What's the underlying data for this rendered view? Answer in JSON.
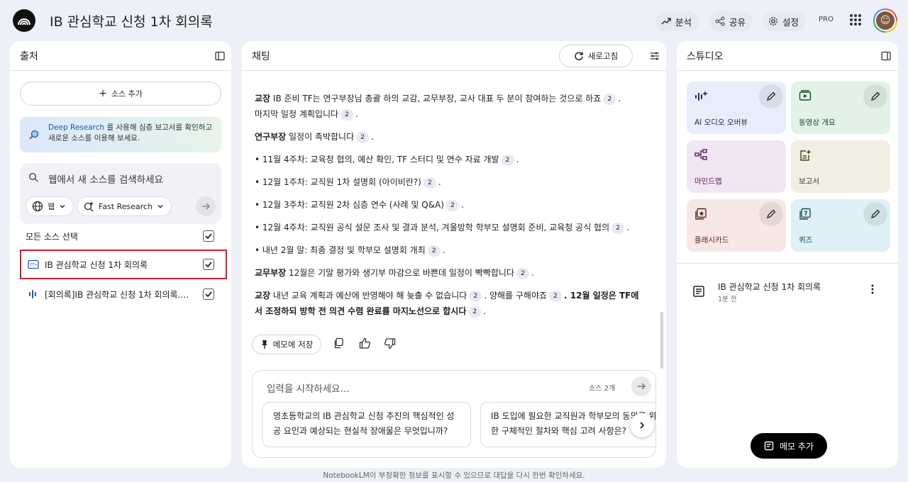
{
  "header": {
    "title": "IB 관심학교 신청 1차 회의록",
    "analyze_label": "분석",
    "share_label": "공유",
    "settings_label": "설정",
    "pro_badge": "PRO"
  },
  "sources_panel": {
    "title": "출처",
    "add_source_label": "소스 추가",
    "deep_research": {
      "link": "Deep Research",
      "text": " 를 사용해 심층 보고서를 확인하고 새로운 소스를 이용해 보세요."
    },
    "search_placeholder": "웹에서 새 소스를 검색하세요",
    "web_chip": "웹",
    "research_chip": "Fast Research",
    "select_all_label": "모든 소스 선택",
    "items": [
      {
        "label": "IB 관심학교 신청 1차 회의록",
        "checked": true,
        "highlighted": true
      },
      {
        "label": "[회의록]IB 관심학교 신청 1차 회의록.m...",
        "checked": true,
        "highlighted": false
      }
    ]
  },
  "chat_panel": {
    "title": "채팅",
    "refresh_label": "새로고침",
    "messages": {
      "p1_speaker": "교장",
      "p1_text": " IB 준비 TF는 연구부장님 총괄 하의 교감, 교무부장, 교사 대표 두 분이 참여하는 것으로 하죠",
      "p1_text2": "마지막 일정 계획입니다",
      "p2_speaker": "연구부장",
      "p2_text": " 일정이 촉박합니다",
      "b1": "• 11월 4주차: 교육청 협의, 예산 확인, TF 스터디 및 연수 자료 개발",
      "b2": "• 12월 1주차: 교직원 1차 설명회 (아이비란?)",
      "b3": "• 12월 3주차: 교직원 2차 심층 연수 (사례 및 Q&A)",
      "b4": "• 12월 4주차: 교직원 공식 설문 조사 및 결과 분석, 겨울방학 학부모 설명회 준비, 교육청 공식 협의",
      "b5": "• 내년 2월 말: 최종 결정 및 학부모 설명회 개최",
      "p3_speaker": "교무부장",
      "p3_text": " 12월은 기말 평가와 생기부 마감으로 바쁜데 일정이 빡빡합니다",
      "p4_speaker": "교장",
      "p4_text": " 내년 교육 계획과 예산에 반영해야 해 늦출 수 없습니다",
      "p4_text2": ". 양해를 구해야죠",
      "p4_bold": ". 12월 일정은 TF에서 조정하되 방학 전 의견 수렴 완료를 마지노선으로 합시다",
      "cite": "2"
    },
    "save_memo_label": "메모에 저장",
    "input_placeholder": "입력을 시작하세요...",
    "source_count": "소스 2개",
    "suggestions": [
      "영초등학교의 IB 관심학교 신청 추진의 핵심적인 성공 요인과 예상되는 현실적 장애물은 무엇입니까?",
      "IB 도입에 필요한 교직원과 학부모의 동의를 위한 구체적인 절차와 핵심 고려 사항은?"
    ]
  },
  "studio_panel": {
    "title": "스튜디오",
    "tiles": [
      {
        "label": "AI 오디오 오버뷰",
        "bg": "#e8edfb",
        "fg": "#1f2a5a"
      },
      {
        "label": "동영상 개요",
        "bg": "#e2f2e6",
        "fg": "#1d4a2a"
      },
      {
        "label": "마인드맵",
        "bg": "#f1e6f3",
        "fg": "#5a1f5e"
      },
      {
        "label": "보고서",
        "bg": "#f1efe3",
        "fg": "#4a4320"
      },
      {
        "label": "플래시카드",
        "bg": "#f7e8e6",
        "fg": "#5a241e"
      },
      {
        "label": "퀴즈",
        "bg": "#dff0f6",
        "fg": "#1d4a5a"
      }
    ],
    "note": {
      "title": "IB 관심학교 신청 1차 회의록",
      "time": "1분 전"
    },
    "add_memo_label": "메모 추가"
  },
  "footer": "NotebookLM이 부정확한 정보를 표시할 수 있으므로 대답을 다시 한번 확인하세요."
}
